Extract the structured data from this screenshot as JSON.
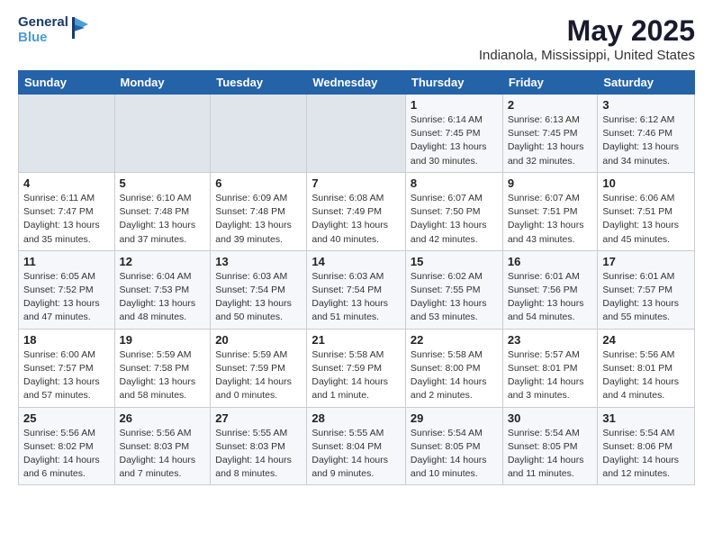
{
  "logo": {
    "line1": "General",
    "line2": "Blue"
  },
  "title": "May 2025",
  "location": "Indianola, Mississippi, United States",
  "days_of_week": [
    "Sunday",
    "Monday",
    "Tuesday",
    "Wednesday",
    "Thursday",
    "Friday",
    "Saturday"
  ],
  "weeks": [
    [
      {
        "day": "",
        "info": ""
      },
      {
        "day": "",
        "info": ""
      },
      {
        "day": "",
        "info": ""
      },
      {
        "day": "",
        "info": ""
      },
      {
        "day": "1",
        "info": "Sunrise: 6:14 AM\nSunset: 7:45 PM\nDaylight: 13 hours and 30 minutes."
      },
      {
        "day": "2",
        "info": "Sunrise: 6:13 AM\nSunset: 7:45 PM\nDaylight: 13 hours and 32 minutes."
      },
      {
        "day": "3",
        "info": "Sunrise: 6:12 AM\nSunset: 7:46 PM\nDaylight: 13 hours and 34 minutes."
      }
    ],
    [
      {
        "day": "4",
        "info": "Sunrise: 6:11 AM\nSunset: 7:47 PM\nDaylight: 13 hours and 35 minutes."
      },
      {
        "day": "5",
        "info": "Sunrise: 6:10 AM\nSunset: 7:48 PM\nDaylight: 13 hours and 37 minutes."
      },
      {
        "day": "6",
        "info": "Sunrise: 6:09 AM\nSunset: 7:48 PM\nDaylight: 13 hours and 39 minutes."
      },
      {
        "day": "7",
        "info": "Sunrise: 6:08 AM\nSunset: 7:49 PM\nDaylight: 13 hours and 40 minutes."
      },
      {
        "day": "8",
        "info": "Sunrise: 6:07 AM\nSunset: 7:50 PM\nDaylight: 13 hours and 42 minutes."
      },
      {
        "day": "9",
        "info": "Sunrise: 6:07 AM\nSunset: 7:51 PM\nDaylight: 13 hours and 43 minutes."
      },
      {
        "day": "10",
        "info": "Sunrise: 6:06 AM\nSunset: 7:51 PM\nDaylight: 13 hours and 45 minutes."
      }
    ],
    [
      {
        "day": "11",
        "info": "Sunrise: 6:05 AM\nSunset: 7:52 PM\nDaylight: 13 hours and 47 minutes."
      },
      {
        "day": "12",
        "info": "Sunrise: 6:04 AM\nSunset: 7:53 PM\nDaylight: 13 hours and 48 minutes."
      },
      {
        "day": "13",
        "info": "Sunrise: 6:03 AM\nSunset: 7:54 PM\nDaylight: 13 hours and 50 minutes."
      },
      {
        "day": "14",
        "info": "Sunrise: 6:03 AM\nSunset: 7:54 PM\nDaylight: 13 hours and 51 minutes."
      },
      {
        "day": "15",
        "info": "Sunrise: 6:02 AM\nSunset: 7:55 PM\nDaylight: 13 hours and 53 minutes."
      },
      {
        "day": "16",
        "info": "Sunrise: 6:01 AM\nSunset: 7:56 PM\nDaylight: 13 hours and 54 minutes."
      },
      {
        "day": "17",
        "info": "Sunrise: 6:01 AM\nSunset: 7:57 PM\nDaylight: 13 hours and 55 minutes."
      }
    ],
    [
      {
        "day": "18",
        "info": "Sunrise: 6:00 AM\nSunset: 7:57 PM\nDaylight: 13 hours and 57 minutes."
      },
      {
        "day": "19",
        "info": "Sunrise: 5:59 AM\nSunset: 7:58 PM\nDaylight: 13 hours and 58 minutes."
      },
      {
        "day": "20",
        "info": "Sunrise: 5:59 AM\nSunset: 7:59 PM\nDaylight: 14 hours and 0 minutes."
      },
      {
        "day": "21",
        "info": "Sunrise: 5:58 AM\nSunset: 7:59 PM\nDaylight: 14 hours and 1 minute."
      },
      {
        "day": "22",
        "info": "Sunrise: 5:58 AM\nSunset: 8:00 PM\nDaylight: 14 hours and 2 minutes."
      },
      {
        "day": "23",
        "info": "Sunrise: 5:57 AM\nSunset: 8:01 PM\nDaylight: 14 hours and 3 minutes."
      },
      {
        "day": "24",
        "info": "Sunrise: 5:56 AM\nSunset: 8:01 PM\nDaylight: 14 hours and 4 minutes."
      }
    ],
    [
      {
        "day": "25",
        "info": "Sunrise: 5:56 AM\nSunset: 8:02 PM\nDaylight: 14 hours and 6 minutes."
      },
      {
        "day": "26",
        "info": "Sunrise: 5:56 AM\nSunset: 8:03 PM\nDaylight: 14 hours and 7 minutes."
      },
      {
        "day": "27",
        "info": "Sunrise: 5:55 AM\nSunset: 8:03 PM\nDaylight: 14 hours and 8 minutes."
      },
      {
        "day": "28",
        "info": "Sunrise: 5:55 AM\nSunset: 8:04 PM\nDaylight: 14 hours and 9 minutes."
      },
      {
        "day": "29",
        "info": "Sunrise: 5:54 AM\nSunset: 8:05 PM\nDaylight: 14 hours and 10 minutes."
      },
      {
        "day": "30",
        "info": "Sunrise: 5:54 AM\nSunset: 8:05 PM\nDaylight: 14 hours and 11 minutes."
      },
      {
        "day": "31",
        "info": "Sunrise: 5:54 AM\nSunset: 8:06 PM\nDaylight: 14 hours and 12 minutes."
      }
    ]
  ]
}
